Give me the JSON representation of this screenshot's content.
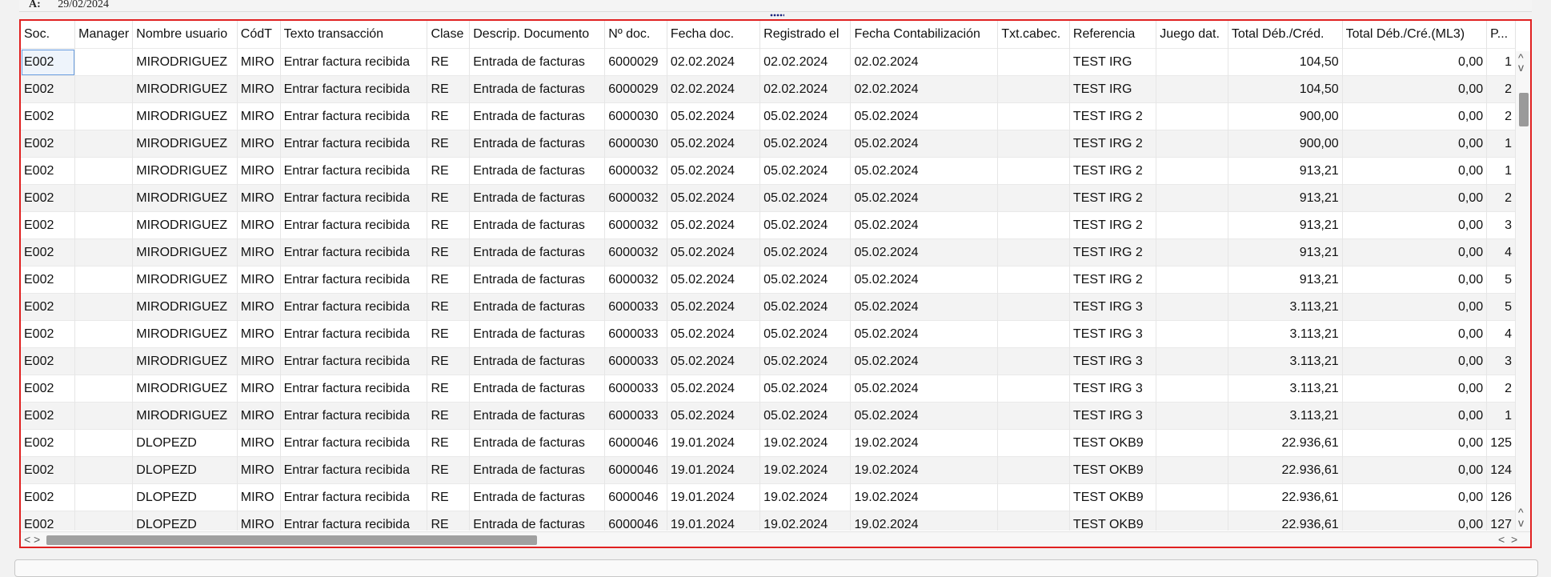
{
  "filter": {
    "label": "A:",
    "value": "29/02/2024"
  },
  "columns": [
    {
      "key": "soc",
      "label": "Soc."
    },
    {
      "key": "manager",
      "label": "Manager"
    },
    {
      "key": "user",
      "label": "Nombre usuario"
    },
    {
      "key": "codt",
      "label": "CódT"
    },
    {
      "key": "text",
      "label": "Texto transacción"
    },
    {
      "key": "clase",
      "label": "Clase"
    },
    {
      "key": "descrip",
      "label": "Descrip. Documento"
    },
    {
      "key": "ndoc",
      "label": "Nº doc."
    },
    {
      "key": "fdoc",
      "label": "Fecha doc."
    },
    {
      "key": "reg",
      "label": "Registrado el"
    },
    {
      "key": "fcont",
      "label": "Fecha Contabilización"
    },
    {
      "key": "txtcab",
      "label": "Txt.cabec."
    },
    {
      "key": "ref",
      "label": "Referencia"
    },
    {
      "key": "juego",
      "label": "Juego dat."
    },
    {
      "key": "total",
      "label": "Total Déb./Créd."
    },
    {
      "key": "totalml3",
      "label": "Total Déb./Cré.(ML3)"
    },
    {
      "key": "p",
      "label": "P..."
    }
  ],
  "rows": [
    [
      "E002",
      "",
      "MIRODRIGUEZ",
      "MIRO",
      "Entrar factura recibida",
      "RE",
      "Entrada de facturas",
      "6000029",
      "02.02.2024",
      "02.02.2024",
      "02.02.2024",
      "",
      "TEST IRG",
      "",
      "104,50",
      "0,00",
      "1"
    ],
    [
      "E002",
      "",
      "MIRODRIGUEZ",
      "MIRO",
      "Entrar factura recibida",
      "RE",
      "Entrada de facturas",
      "6000029",
      "02.02.2024",
      "02.02.2024",
      "02.02.2024",
      "",
      "TEST IRG",
      "",
      "104,50",
      "0,00",
      "2"
    ],
    [
      "E002",
      "",
      "MIRODRIGUEZ",
      "MIRO",
      "Entrar factura recibida",
      "RE",
      "Entrada de facturas",
      "6000030",
      "05.02.2024",
      "05.02.2024",
      "05.02.2024",
      "",
      "TEST IRG 2",
      "",
      "900,00",
      "0,00",
      "2"
    ],
    [
      "E002",
      "",
      "MIRODRIGUEZ",
      "MIRO",
      "Entrar factura recibida",
      "RE",
      "Entrada de facturas",
      "6000030",
      "05.02.2024",
      "05.02.2024",
      "05.02.2024",
      "",
      "TEST IRG 2",
      "",
      "900,00",
      "0,00",
      "1"
    ],
    [
      "E002",
      "",
      "MIRODRIGUEZ",
      "MIRO",
      "Entrar factura recibida",
      "RE",
      "Entrada de facturas",
      "6000032",
      "05.02.2024",
      "05.02.2024",
      "05.02.2024",
      "",
      "TEST IRG 2",
      "",
      "913,21",
      "0,00",
      "1"
    ],
    [
      "E002",
      "",
      "MIRODRIGUEZ",
      "MIRO",
      "Entrar factura recibida",
      "RE",
      "Entrada de facturas",
      "6000032",
      "05.02.2024",
      "05.02.2024",
      "05.02.2024",
      "",
      "TEST IRG 2",
      "",
      "913,21",
      "0,00",
      "2"
    ],
    [
      "E002",
      "",
      "MIRODRIGUEZ",
      "MIRO",
      "Entrar factura recibida",
      "RE",
      "Entrada de facturas",
      "6000032",
      "05.02.2024",
      "05.02.2024",
      "05.02.2024",
      "",
      "TEST IRG 2",
      "",
      "913,21",
      "0,00",
      "3"
    ],
    [
      "E002",
      "",
      "MIRODRIGUEZ",
      "MIRO",
      "Entrar factura recibida",
      "RE",
      "Entrada de facturas",
      "6000032",
      "05.02.2024",
      "05.02.2024",
      "05.02.2024",
      "",
      "TEST IRG 2",
      "",
      "913,21",
      "0,00",
      "4"
    ],
    [
      "E002",
      "",
      "MIRODRIGUEZ",
      "MIRO",
      "Entrar factura recibida",
      "RE",
      "Entrada de facturas",
      "6000032",
      "05.02.2024",
      "05.02.2024",
      "05.02.2024",
      "",
      "TEST IRG 2",
      "",
      "913,21",
      "0,00",
      "5"
    ],
    [
      "E002",
      "",
      "MIRODRIGUEZ",
      "MIRO",
      "Entrar factura recibida",
      "RE",
      "Entrada de facturas",
      "6000033",
      "05.02.2024",
      "05.02.2024",
      "05.02.2024",
      "",
      "TEST IRG 3",
      "",
      "3.113,21",
      "0,00",
      "5"
    ],
    [
      "E002",
      "",
      "MIRODRIGUEZ",
      "MIRO",
      "Entrar factura recibida",
      "RE",
      "Entrada de facturas",
      "6000033",
      "05.02.2024",
      "05.02.2024",
      "05.02.2024",
      "",
      "TEST IRG 3",
      "",
      "3.113,21",
      "0,00",
      "4"
    ],
    [
      "E002",
      "",
      "MIRODRIGUEZ",
      "MIRO",
      "Entrar factura recibida",
      "RE",
      "Entrada de facturas",
      "6000033",
      "05.02.2024",
      "05.02.2024",
      "05.02.2024",
      "",
      "TEST IRG 3",
      "",
      "3.113,21",
      "0,00",
      "3"
    ],
    [
      "E002",
      "",
      "MIRODRIGUEZ",
      "MIRO",
      "Entrar factura recibida",
      "RE",
      "Entrada de facturas",
      "6000033",
      "05.02.2024",
      "05.02.2024",
      "05.02.2024",
      "",
      "TEST IRG 3",
      "",
      "3.113,21",
      "0,00",
      "2"
    ],
    [
      "E002",
      "",
      "MIRODRIGUEZ",
      "MIRO",
      "Entrar factura recibida",
      "RE",
      "Entrada de facturas",
      "6000033",
      "05.02.2024",
      "05.02.2024",
      "05.02.2024",
      "",
      "TEST IRG 3",
      "",
      "3.113,21",
      "0,00",
      "1"
    ],
    [
      "E002",
      "",
      "DLOPEZD",
      "MIRO",
      "Entrar factura recibida",
      "RE",
      "Entrada de facturas",
      "6000046",
      "19.01.2024",
      "19.02.2024",
      "19.02.2024",
      "",
      "TEST OKB9",
      "",
      "22.936,61",
      "0,00",
      "125"
    ],
    [
      "E002",
      "",
      "DLOPEZD",
      "MIRO",
      "Entrar factura recibida",
      "RE",
      "Entrada de facturas",
      "6000046",
      "19.01.2024",
      "19.02.2024",
      "19.02.2024",
      "",
      "TEST OKB9",
      "",
      "22.936,61",
      "0,00",
      "124"
    ],
    [
      "E002",
      "",
      "DLOPEZD",
      "MIRO",
      "Entrar factura recibida",
      "RE",
      "Entrada de facturas",
      "6000046",
      "19.01.2024",
      "19.02.2024",
      "19.02.2024",
      "",
      "TEST OKB9",
      "",
      "22.936,61",
      "0,00",
      "126"
    ],
    [
      "E002",
      "",
      "DLOPEZD",
      "MIRO",
      "Entrar factura recibida",
      "RE",
      "Entrada de facturas",
      "6000046",
      "19.01.2024",
      "19.02.2024",
      "19.02.2024",
      "",
      "TEST OKB9",
      "",
      "22.936,61",
      "0,00",
      "127"
    ]
  ],
  "scroll": {
    "up_icon": "chevron-up-icon",
    "down_icon": "chevron-down-icon",
    "left_icon": "chevron-left-icon",
    "right_icon": "chevron-right-icon",
    "up_glyph": "^",
    "down_glyph": "v",
    "left_glyph": "<",
    "right_glyph": ">"
  },
  "colors": {
    "frame_border": "#e02020",
    "selection": "#6a9ee0"
  }
}
